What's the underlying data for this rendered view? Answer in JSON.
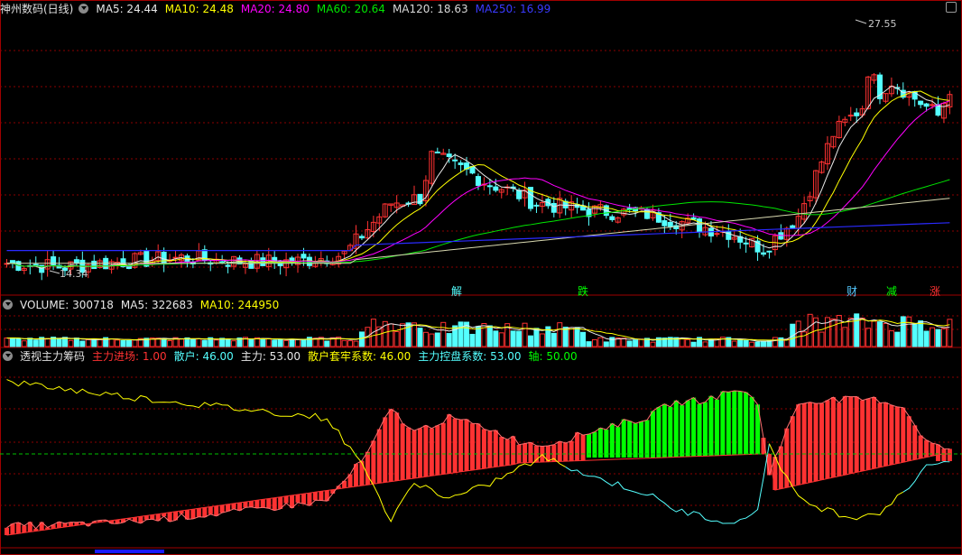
{
  "main_header": {
    "title": "神州数码(日线)",
    "ma5": "MA5: 24.44",
    "ma10": "MA10: 24.48",
    "ma20": "MA20: 24.80",
    "ma60": "MA60: 20.64",
    "ma120": "MA120: 18.63",
    "ma250": "MA250: 16.99"
  },
  "price_labels": {
    "high": "27.55",
    "low": "14.34"
  },
  "event_tags": [
    "解",
    "跌",
    "财",
    "减",
    "涨"
  ],
  "volume_header": {
    "volume": "VOLUME: 300718",
    "ma5": "MA5: 322683",
    "ma10": "MA10: 244950"
  },
  "indicator_header": {
    "title": "透视主力筹码",
    "entry": "主力进场: 1.00",
    "retail": "散户: 46.00",
    "main": "主力: 53.00",
    "retail_trap": "散户套牢系数: 46.00",
    "control": "主力控盘系数: 53.00",
    "axis": "轴: 50.00"
  },
  "colors": {
    "up": "#ff3232",
    "down": "#54ffff",
    "ma5": "#e8e8e8",
    "ma10": "#ffff00",
    "ma20": "#ff00ff",
    "ma60": "#00e600",
    "ma120": "#d8d8b0",
    "ma250": "#2a2aff",
    "grid": "#8b0000",
    "bar_green": "#00ff00",
    "axis_line": "#00c000"
  },
  "chart_data": [
    {
      "type": "candlestick",
      "title": "神州数码(日线)",
      "ylim": [
        13.6,
        28.6
      ],
      "high_marker": 27.55,
      "low_marker": 14.34,
      "x_count": 150,
      "close_keypoints": [
        [
          0,
          14.9
        ],
        [
          10,
          14.7
        ],
        [
          20,
          15.0
        ],
        [
          30,
          15.2
        ],
        [
          40,
          15.0
        ],
        [
          50,
          15.0
        ],
        [
          58,
          15.4
        ],
        [
          62,
          16.8
        ],
        [
          66,
          18.2
        ],
        [
          71,
          18.5
        ],
        [
          73,
          20.8
        ],
        [
          80,
          19.8
        ],
        [
          82,
          19.4
        ],
        [
          87,
          18.8
        ],
        [
          91,
          18.2
        ],
        [
          100,
          17.8
        ],
        [
          110,
          17.6
        ],
        [
          118,
          17.0
        ],
        [
          124,
          16.6
        ],
        [
          130,
          15.7
        ],
        [
          136,
          17.5
        ],
        [
          142,
          22.0
        ],
        [
          147,
          23.5
        ],
        [
          148,
          25.5
        ],
        [
          150,
          24.3
        ],
        [
          152,
          24.9
        ],
        [
          155,
          24.2
        ],
        [
          160,
          23.0
        ],
        [
          162,
          24.5
        ]
      ],
      "moving_averages": [
        "MA5",
        "MA10",
        "MA20",
        "MA60",
        "MA120",
        "MA250"
      ],
      "ma_values": [
        24.44,
        24.48,
        24.8,
        20.64,
        18.63,
        16.99
      ]
    },
    {
      "type": "bar",
      "title": "VOLUME",
      "values_last": 300718,
      "ma5": 322683,
      "ma10": 244950
    },
    {
      "type": "bar",
      "title": "透视主力筹码",
      "ylim": [
        0,
        100
      ],
      "series": [
        {
          "name": "主力",
          "values_last": 53.0
        },
        {
          "name": "散户",
          "values_last": 46.0
        }
      ],
      "axis": 50.0,
      "main_keypoints": [
        [
          0,
          10
        ],
        [
          20,
          12
        ],
        [
          40,
          18
        ],
        [
          55,
          24
        ],
        [
          62,
          50
        ],
        [
          66,
          75
        ],
        [
          70,
          62
        ],
        [
          76,
          70
        ],
        [
          82,
          65
        ],
        [
          88,
          57
        ],
        [
          92,
          55
        ],
        [
          96,
          58
        ],
        [
          100,
          62
        ],
        [
          104,
          66
        ],
        [
          110,
          70
        ],
        [
          114,
          78
        ],
        [
          120,
          80
        ],
        [
          126,
          86
        ],
        [
          129,
          78
        ],
        [
          131,
          40
        ],
        [
          136,
          78
        ],
        [
          140,
          80
        ],
        [
          145,
          80
        ],
        [
          150,
          80
        ],
        [
          154,
          76
        ],
        [
          158,
          57
        ],
        [
          160,
          54
        ],
        [
          162,
          53
        ]
      ],
      "retail_keypoints": [
        [
          0,
          90
        ],
        [
          20,
          82
        ],
        [
          40,
          75
        ],
        [
          55,
          70
        ],
        [
          62,
          40
        ],
        [
          66,
          12
        ],
        [
          70,
          35
        ],
        [
          76,
          25
        ],
        [
          82,
          32
        ],
        [
          88,
          42
        ],
        [
          92,
          48
        ],
        [
          96,
          44
        ],
        [
          100,
          38
        ],
        [
          104,
          34
        ],
        [
          110,
          28
        ],
        [
          114,
          20
        ],
        [
          120,
          15
        ],
        [
          126,
          12
        ],
        [
          129,
          20
        ],
        [
          131,
          55
        ],
        [
          136,
          25
        ],
        [
          140,
          20
        ],
        [
          145,
          15
        ],
        [
          150,
          18
        ],
        [
          154,
          28
        ],
        [
          158,
          44
        ],
        [
          160,
          46
        ],
        [
          162,
          46
        ]
      ]
    }
  ]
}
